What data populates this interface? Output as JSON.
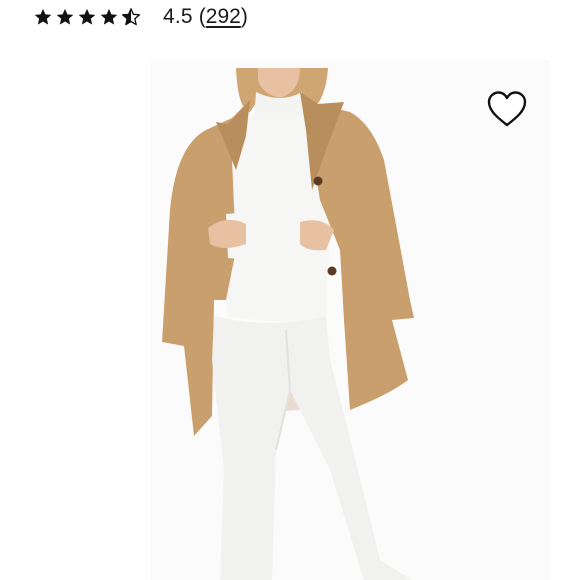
{
  "rating": {
    "stars": [
      {
        "icon": "star-full-icon",
        "fill": 1
      },
      {
        "icon": "star-full-icon",
        "fill": 1
      },
      {
        "icon": "star-full-icon",
        "fill": 1
      },
      {
        "icon": "star-full-icon",
        "fill": 1
      },
      {
        "icon": "star-half-icon",
        "fill": 0.5
      }
    ],
    "value": "4.5",
    "open_paren": "(",
    "count": "292",
    "close_paren": ")"
  },
  "product": {
    "image_icon": "product-photo",
    "wishlist_icon": "heart-outline-icon"
  },
  "colors": {
    "star": "#111111",
    "text": "#1a1a1a",
    "coat": "#c9a06d",
    "heart_stroke": "#111111"
  }
}
